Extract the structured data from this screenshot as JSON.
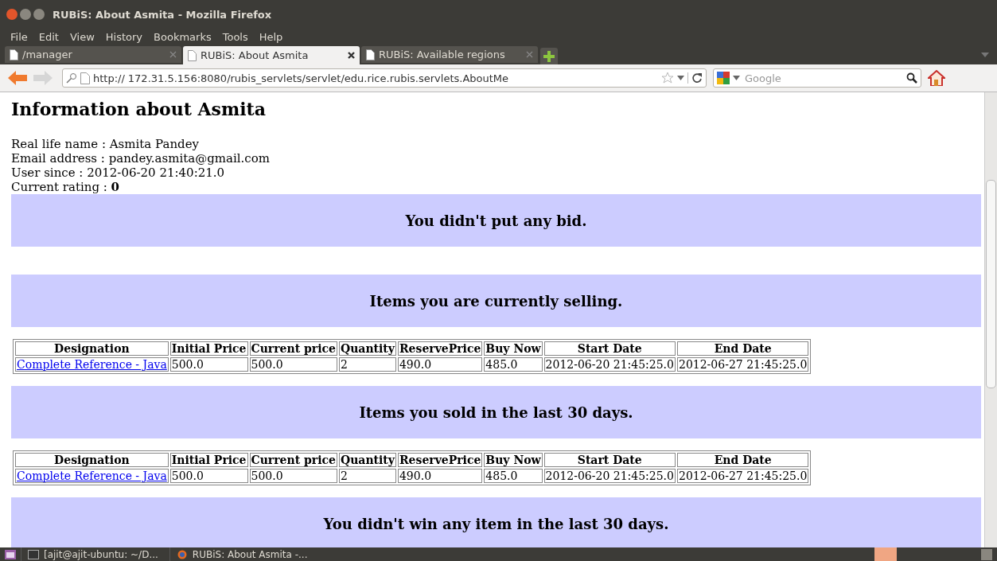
{
  "window": {
    "title": "RUBiS: About Asmita - Mozilla Firefox"
  },
  "menu": [
    "File",
    "Edit",
    "View",
    "History",
    "Bookmarks",
    "Tools",
    "Help"
  ],
  "tabs": [
    {
      "label": "/manager",
      "selected": false
    },
    {
      "label": "RUBiS: About Asmita",
      "selected": true
    },
    {
      "label": "RUBiS: Available regions",
      "selected": false
    }
  ],
  "navbar": {
    "scheme": "http://",
    "url": "172.31.5.156:8080/rubis_servlets/servlet/edu.rice.rubis.servlets.AboutMe",
    "search_placeholder": "Google"
  },
  "page": {
    "heading": "Information about Asmita",
    "info": [
      "Real life name : Asmita Pandey",
      "Email address : pandey.asmita@gmail.com",
      "User since : 2012-06-20 21:40:21.0",
      "Current rating : **0**"
    ],
    "sections": [
      {
        "kind": "banner",
        "text": "You didn't put any bid."
      },
      {
        "kind": "banner",
        "text": "Items you are currently selling."
      },
      {
        "kind": "table",
        "columns": [
          "Designation",
          "Initial Price",
          "Current price",
          "Quantity",
          "ReservePrice",
          "Buy Now",
          "Start Date",
          "End Date"
        ],
        "rows": [
          [
            "Complete Reference - Java",
            "500.0",
            "500.0",
            "2",
            "490.0",
            "485.0",
            "2012-06-20 21:45:25.0",
            "2012-06-27 21:45:25.0"
          ]
        ]
      },
      {
        "kind": "banner",
        "text": "Items you sold in the last 30 days."
      },
      {
        "kind": "table",
        "columns": [
          "Designation",
          "Initial Price",
          "Current price",
          "Quantity",
          "ReservePrice",
          "Buy Now",
          "Start Date",
          "End Date"
        ],
        "rows": [
          [
            "Complete Reference - Java",
            "500.0",
            "500.0",
            "2",
            "490.0",
            "485.0",
            "2012-06-20 21:45:25.0",
            "2012-06-27 21:45:25.0"
          ]
        ]
      },
      {
        "kind": "banner",
        "text": "You didn't win any item in the last 30 days."
      }
    ]
  },
  "taskbar": [
    {
      "label": "[ajit@ajit-ubuntu: ~/D...",
      "kind": "terminal"
    },
    {
      "label": "RUBiS: About Asmita -...",
      "kind": "browser"
    }
  ]
}
